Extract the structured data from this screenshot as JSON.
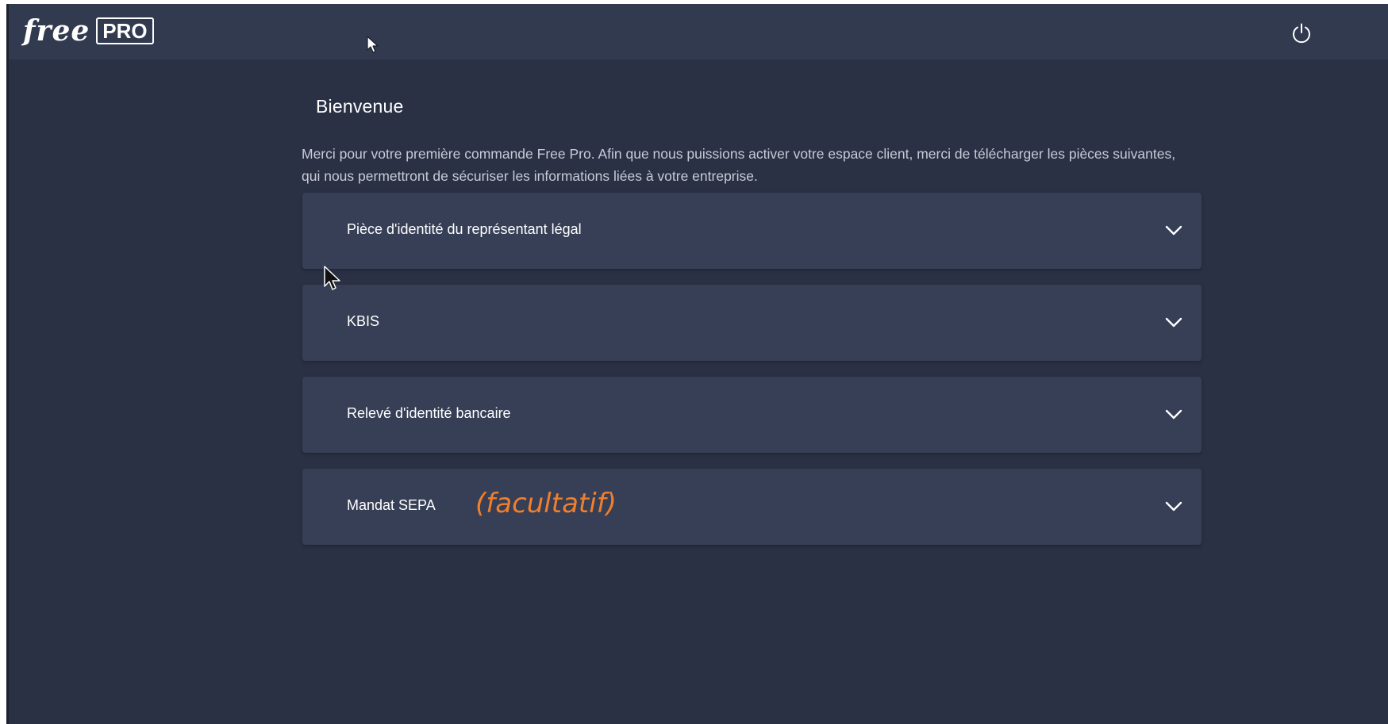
{
  "header": {
    "logo_text": "free",
    "logo_badge": "PRO",
    "power_icon": "power-icon"
  },
  "main": {
    "title": "Bienvenue",
    "intro": "Merci pour votre première commande Free Pro. Afin que nous puissions activer votre espace client, merci de télécharger les pièces suivantes, qui nous permettront de sécuriser les informations liées à votre entreprise."
  },
  "documents": [
    {
      "label": "Pièce d'identité du représentant légal",
      "note": ""
    },
    {
      "label": "KBIS",
      "note": ""
    },
    {
      "label": "Relevé d'identité bancaire",
      "note": ""
    },
    {
      "label": "Mandat SEPA",
      "note": "(facultatif)"
    }
  ],
  "colors": {
    "background": "#2a3145",
    "header": "#323a50",
    "panel": "#363f56",
    "note": "#f07f2d"
  }
}
